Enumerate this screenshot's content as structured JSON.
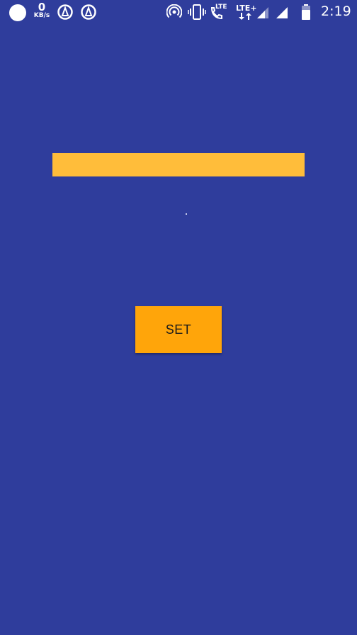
{
  "status_bar": {
    "net_speed_value": "0",
    "net_speed_unit": "KB/s",
    "network_type_1": "LTE",
    "network_type_2": "LTE+",
    "time": "2:19",
    "icons": [
      "circle-icon",
      "speedometer-icon",
      "speedometer-icon",
      "hotspot-icon",
      "vibrate-icon",
      "volte-call-icon",
      "data-arrows-icon",
      "signal-icon",
      "signal-icon",
      "battery-icon"
    ]
  },
  "main": {
    "input_value": "",
    "button_label": "SET"
  },
  "colors": {
    "background": "#2f3d9c",
    "input_fill": "#ffbd3a",
    "button_fill": "#ffa50a"
  }
}
